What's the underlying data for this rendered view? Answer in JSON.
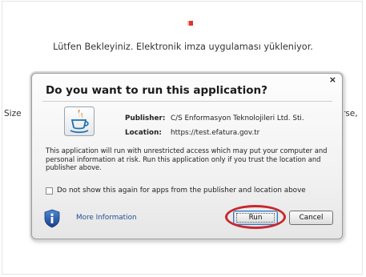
{
  "page": {
    "wait_message": "Lütfen Bekleyiniz. Elektronik imza uygulaması yükleniyor.",
    "side_left_text": "Size",
    "side_right_text": "rse,"
  },
  "dialog": {
    "close_glyph": "×",
    "title": "Do you want to run this application?",
    "publisher_label": "Publisher:",
    "publisher_value": "C/S Enformasyon Teknolojileri Ltd. Sti.",
    "location_label": "Location:",
    "location_value": "https://test.efatura.gov.tr",
    "warning_text": "This application will run with unrestricted access which may put your computer and personal information at risk. Run this application only if you trust the location and publisher above.",
    "checkbox_label": "Do not show this again for apps from the publisher and location above",
    "checkbox_checked": false,
    "more_info_label": "More Information",
    "run_label": "Run",
    "cancel_label": "Cancel",
    "icons": {
      "app": "java-coffee-cup-icon",
      "info": "information-shield-icon"
    }
  },
  "colors": {
    "highlight": "#c8282e",
    "link": "#1f4f8f",
    "loader": "#e0352b",
    "java_blue": "#1d6fb0",
    "java_orange": "#e5731e",
    "info_blue": "#1f5aa6"
  }
}
